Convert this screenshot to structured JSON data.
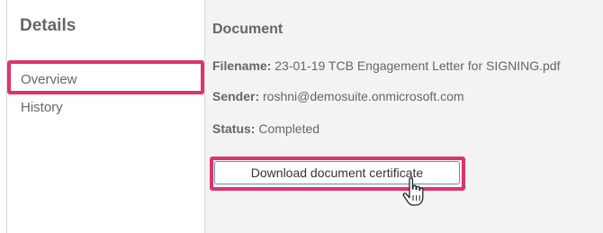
{
  "sidebar": {
    "title": "Details",
    "items": [
      {
        "label": "Overview",
        "active": true
      },
      {
        "label": "History",
        "active": false
      }
    ]
  },
  "document": {
    "section_title": "Document",
    "filename_label": "Filename:",
    "filename_value": "23-01-19 TCB Engagement Letter for SIGNING.pdf",
    "sender_label": "Sender:",
    "sender_value": "roshni@demosuite.onmicrosoft.com",
    "status_label": "Status:",
    "status_value": "Completed",
    "download_label": "Download document certificate"
  },
  "colors": {
    "highlight": "#e0336b",
    "active_indicator": "#2f6fd6",
    "button_border": "#6a8fd0",
    "panel_background": "#f3f3f3"
  },
  "icons": {
    "cursor": "hand-pointer-icon"
  }
}
